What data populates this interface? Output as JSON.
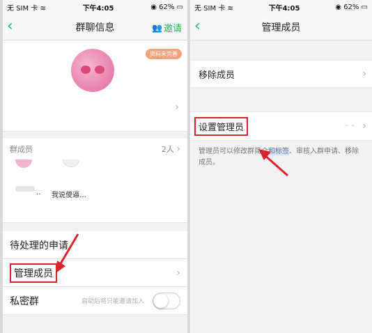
{
  "left": {
    "status": {
      "carrier": "无 SIM 卡",
      "wifi_icon": "wifi-icon",
      "time": "下午4:05",
      "battery": "62%",
      "lock_icon": "orientation-lock-icon"
    },
    "nav": {
      "back": "‹",
      "title": "群聊信息",
      "invite_label": "邀请",
      "invite_icon": "people-icon"
    },
    "profile": {
      "badge": "资料未完善",
      "chevron": "›"
    },
    "members": {
      "label": "群成员",
      "count": "2人",
      "chevron": "›",
      "member_text": "我说傻逼…",
      "dots": ".."
    },
    "rows": {
      "pending": "待处理的申请",
      "manage": "管理成员",
      "manage_chevron": "›",
      "private": "私密群",
      "private_hint": "启动后将只能邀请加入",
      "private_toggle": false
    }
  },
  "right": {
    "status": {
      "carrier": "无 SIM 卡",
      "wifi_icon": "wifi-icon",
      "time": "下午4:05",
      "battery": "62%",
      "lock_icon": "orientation-lock-icon"
    },
    "nav": {
      "back": "‹",
      "title": "管理成员"
    },
    "rows": {
      "remove": "移除成员",
      "remove_chevron": "›",
      "set_admin": "设置管理员",
      "set_admin_tiny": "^ ^",
      "set_admin_chevron": "›"
    },
    "desc": {
      "part1": "管理员可以修改群简介",
      "part2": "和标签",
      "part3": "、审核入群申请、移除成员。"
    }
  },
  "colors": {
    "accent_green": "#25b35b",
    "highlight_red": "#d9232f",
    "badge_orange": "#f4a27b"
  }
}
